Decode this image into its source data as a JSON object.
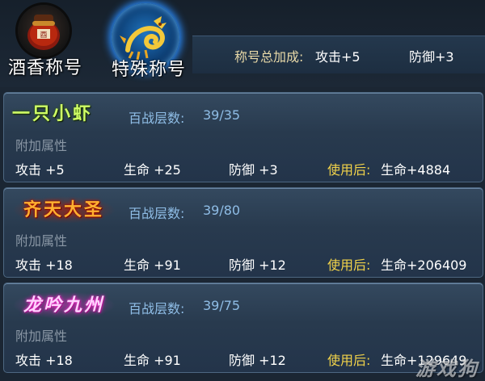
{
  "tabs": [
    {
      "label": "酒香称号",
      "icon": "wine-jar-icon"
    },
    {
      "label": "特殊称号",
      "icon": "dragon-icon"
    }
  ],
  "bonus": {
    "label": "称号总加成:",
    "attack": "攻击+5",
    "defense": "防御+3"
  },
  "titles": [
    {
      "name": "一只小虾",
      "layers_label": "百战层数:",
      "layers": "39/35",
      "extra_label": "附加属性",
      "attack": "攻击 +5",
      "life": "生命 +25",
      "defense": "防御 +3",
      "use_label": "使用后:",
      "use_value": "生命+4884"
    },
    {
      "name": "齐天大圣",
      "layers_label": "百战层数:",
      "layers": "39/80",
      "extra_label": "附加属性",
      "attack": "攻击 +18",
      "life": "生命 +91",
      "defense": "防御 +12",
      "use_label": "使用后:",
      "use_value": "生命+206409"
    },
    {
      "name": "龙吟九州",
      "layers_label": "百战层数:",
      "layers": "39/75",
      "extra_label": "附加属性",
      "attack": "攻击 +18",
      "life": "生命 +91",
      "defense": "防御 +12",
      "use_label": "使用后:",
      "use_value": "生命+129649"
    }
  ],
  "watermark": "游戏狗"
}
